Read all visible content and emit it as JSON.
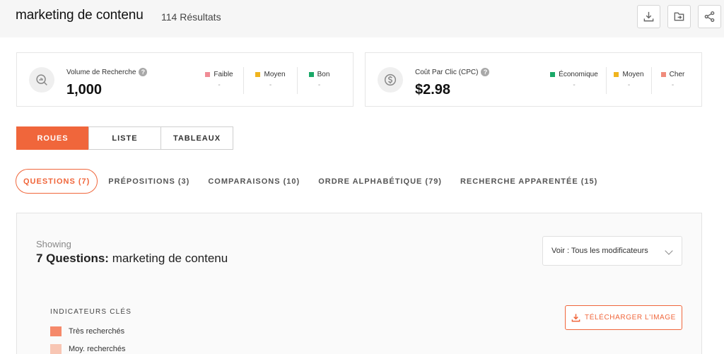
{
  "header": {
    "title": "marketing de contenu",
    "results": "114 Résultats",
    "actions": [
      {
        "icon": "download-icon"
      },
      {
        "icon": "export-icon"
      },
      {
        "icon": "share-icon"
      }
    ]
  },
  "cards": {
    "volume": {
      "icon": "search-chart-icon",
      "label": "Volume de Recherche",
      "value": "1,000",
      "legend": [
        {
          "label": "Faible",
          "color": "#f08c96",
          "value": "-"
        },
        {
          "label": "Moyen",
          "color": "#f0b41e",
          "value": "-"
        },
        {
          "label": "Bon",
          "color": "#1aa868",
          "value": "-"
        }
      ]
    },
    "cpc": {
      "icon": "dollar-icon",
      "label": "Coût Par Clic (CPC)",
      "value": "$2.98",
      "legend": [
        {
          "label": "Économique",
          "color": "#1aa868",
          "value": "-"
        },
        {
          "label": "Moyen",
          "color": "#f0b41e",
          "value": "-"
        },
        {
          "label": "Cher",
          "color": "#f08c7c",
          "value": "-"
        }
      ]
    }
  },
  "view_tabs": [
    {
      "label": "ROUES",
      "active": true
    },
    {
      "label": "LISTE",
      "active": false
    },
    {
      "label": "TABLEAUX",
      "active": false
    }
  ],
  "sub_tabs": [
    {
      "label": "QUESTIONS (7)",
      "active": true
    },
    {
      "label": "PRÉPOSITIONS (3)",
      "active": false
    },
    {
      "label": "COMPARAISONS (10)",
      "active": false
    },
    {
      "label": "ORDRE ALPHABÉTIQUE (79)",
      "active": false
    },
    {
      "label": "RECHERCHE APPARENTÉE (15)",
      "active": false
    }
  ],
  "panel": {
    "showing": "Showing",
    "heading_bold": "7 Questions:",
    "heading_rest": "marketing de contenu",
    "modifier_select": "Voir : Tous les modificateurs",
    "indicators_title": "INDICATEURS CLÉS",
    "indicators": [
      {
        "label": "Très recherchés",
        "color": "#f5896a"
      },
      {
        "label": "Moy. recherchés",
        "color": "#f8c6b4"
      }
    ],
    "download_label": "TÉLÉCHARGER L'IMAGE"
  },
  "colors": {
    "accent": "#f0663b"
  }
}
